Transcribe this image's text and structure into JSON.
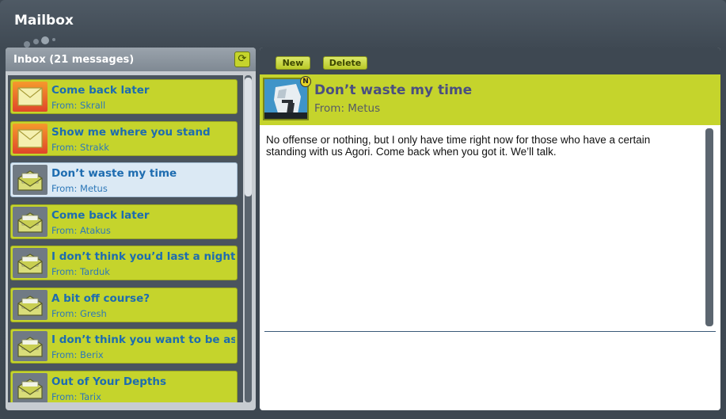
{
  "window": {
    "title": "Mailbox"
  },
  "inbox": {
    "title": "Inbox (21 messages)",
    "messages": [
      {
        "subject": "Come back later",
        "from": "From: Skrall",
        "status": "new"
      },
      {
        "subject": "Show me where you stand",
        "from": "From: Strakk",
        "status": "new"
      },
      {
        "subject": "Don’t waste my time",
        "from": "From: Metus",
        "status": "selected"
      },
      {
        "subject": "Come back later",
        "from": "From: Atakus",
        "status": "read"
      },
      {
        "subject": "I don’t think you’d last a night in th",
        "from": "From: Tarduk",
        "status": "read"
      },
      {
        "subject": "A bit off course?",
        "from": "From: Gresh",
        "status": "read"
      },
      {
        "subject": "I don’t think you want to be associ",
        "from": "From: Berix",
        "status": "read"
      },
      {
        "subject": "Out of Your Depths",
        "from": "From: Tarix",
        "status": "read"
      }
    ]
  },
  "toolbar": {
    "new_label": "New",
    "delete_label": "Delete"
  },
  "message": {
    "subject": "Don’t waste my time",
    "from": "From: Metus",
    "badge": "N",
    "body": "No offense or nothing, but I only have time right now for those who have a certain standing with us Agori. Come back when you got it. We’ll talk."
  },
  "icons": {
    "refresh": "refresh-icon",
    "envelope": "envelope-icon"
  },
  "colors": {
    "accent": "#c5d42c",
    "link": "#1d6cb0",
    "background": "#3e4852",
    "new_mail": "#e8672b"
  }
}
